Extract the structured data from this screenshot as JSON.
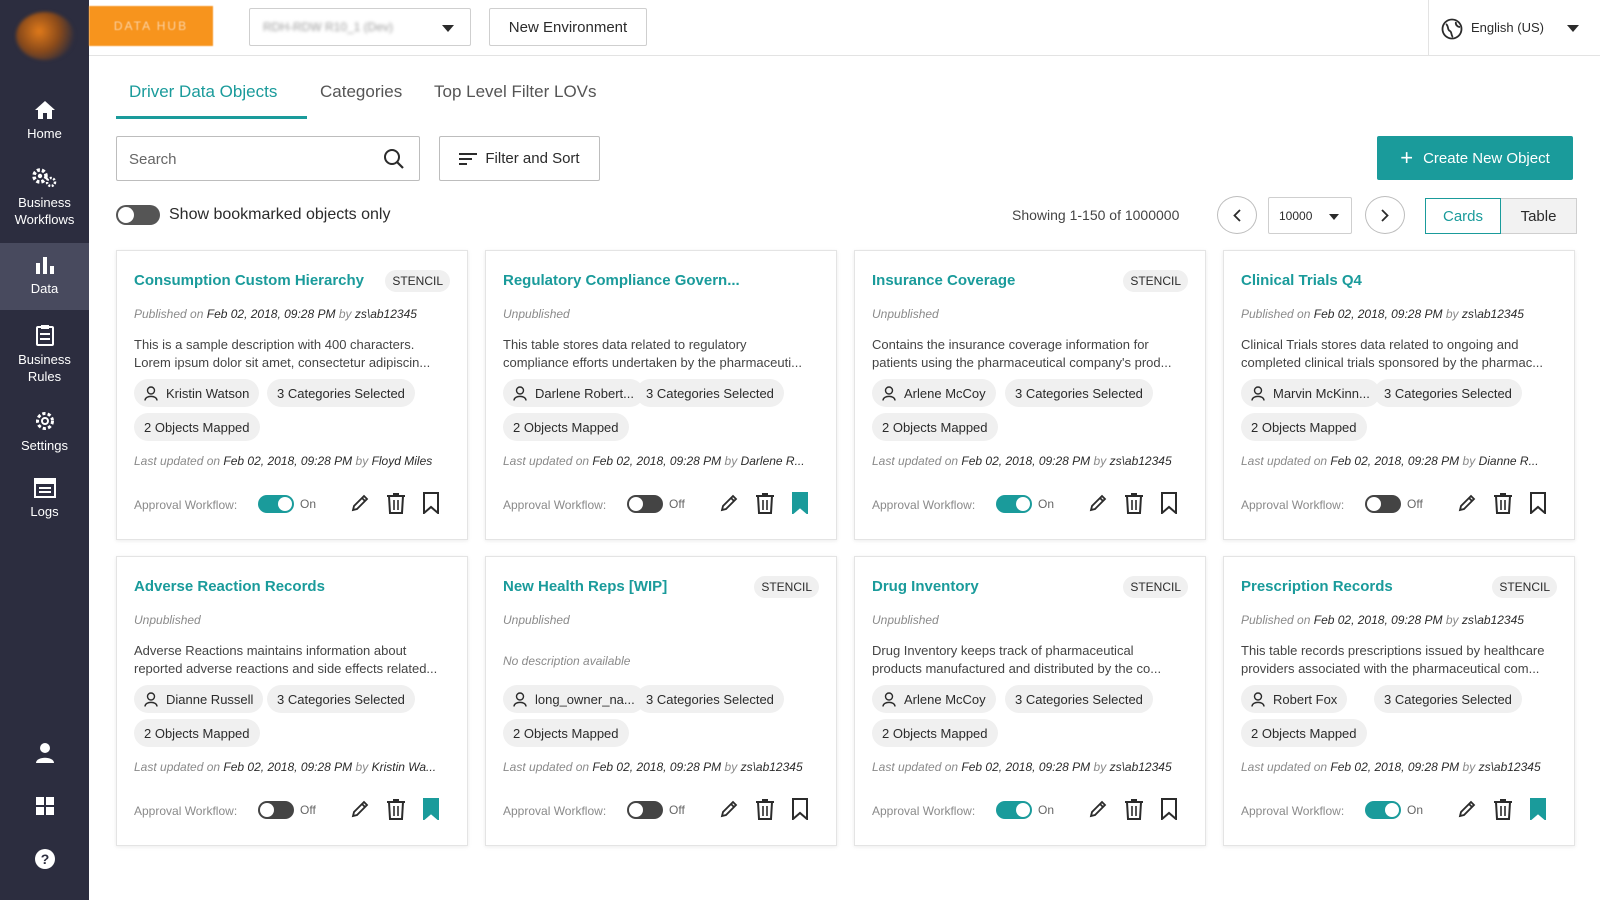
{
  "sidebar": {
    "items": [
      {
        "label": "Home",
        "icon": "home-icon"
      },
      {
        "label": "Business\nWorkflows",
        "icon": "cogs-icon"
      },
      {
        "label": "Data",
        "icon": "bar-chart-icon"
      },
      {
        "label": "Business\nRules",
        "icon": "clipboard-icon"
      },
      {
        "label": "Settings",
        "icon": "gear-icon"
      },
      {
        "label": "Logs",
        "icon": "logs-icon"
      }
    ],
    "bottom": [
      "user-icon",
      "grid-icon",
      "help-icon"
    ]
  },
  "topbar": {
    "brand": "DATA HUB",
    "env_value": "RDH-RDW R10_1 (Dev)",
    "new_env_label": "New Environment",
    "language": "English (US)"
  },
  "tabs": [
    "Driver Data Objects",
    "Categories",
    "Top Level Filter LOVs"
  ],
  "toolbar": {
    "search_placeholder": "Search",
    "filter_label": "Filter and Sort",
    "create_label": "Create New Object",
    "bookmark_label": "Show bookmarked objects only",
    "showing": "Showing 1-150 of 1000000",
    "per_page": "10000",
    "view_cards": "Cards",
    "view_table": "Table"
  },
  "labels": {
    "published_on": "Published on",
    "by": "by",
    "last_updated_on": "Last updated on",
    "approval_workflow": "Approval Workflow:"
  },
  "colors": {
    "accent": "#1a9b9b",
    "brand": "#f7941d",
    "sidebar": "#2c2d3f"
  },
  "cards": [
    {
      "title": "Consumption Custom Hierarchy",
      "stencil": "STENCIL",
      "status": "published",
      "unpublished": "",
      "published_date": "Feb 02, 2018, 09:28 PM",
      "published_by": "zs\\ab12345",
      "desc1": "This is a sample description with 400 characters.",
      "desc2": "Lorem ipsum dolor sit amet, consectetur adipiscin...",
      "owner": "Kristin Watson",
      "categories": "3 Categories Selected",
      "objects": "2 Objects Mapped",
      "updated_date": "Feb 02, 2018, 09:28 PM",
      "updated_by": "Floyd Miles",
      "workflow": "On",
      "bookmarked": false
    },
    {
      "title": "Regulatory Compliance Govern...",
      "stencil": "",
      "status": "unpublished",
      "unpublished": "Unpublished",
      "published_date": "",
      "published_by": "",
      "desc1": "This table stores data related to regulatory",
      "desc2": "compliance efforts undertaken by the pharmaceuti...",
      "owner": "Darlene Robert...",
      "categories": "3 Categories Selected",
      "objects": "2 Objects Mapped",
      "updated_date": "Feb 02, 2018, 09:28 PM",
      "updated_by": "Darlene R...",
      "workflow": "Off",
      "bookmarked": true
    },
    {
      "title": "Insurance Coverage",
      "stencil": "STENCIL",
      "status": "unpublished",
      "unpublished": "Unpublished",
      "published_date": "",
      "published_by": "",
      "desc1": "Contains the insurance coverage information for",
      "desc2": "patients using the pharmaceutical company's prod...",
      "owner": "Arlene McCoy",
      "categories": "3 Categories Selected",
      "objects": "2 Objects Mapped",
      "updated_date": "Feb 02, 2018, 09:28 PM",
      "updated_by": "zs\\ab12345",
      "workflow": "On",
      "bookmarked": false
    },
    {
      "title": "Clinical Trials Q4",
      "stencil": "",
      "status": "published",
      "unpublished": "",
      "published_date": "Feb 02, 2018, 09:28 PM",
      "published_by": "zs\\ab12345",
      "desc1": "Clinical Trials stores data related to ongoing and",
      "desc2": "completed clinical trials sponsored by the pharmac...",
      "owner": "Marvin McKinn...",
      "categories": "3 Categories Selected",
      "objects": "2 Objects Mapped",
      "updated_date": "Feb 02, 2018, 09:28 PM",
      "updated_by": "Dianne R...",
      "workflow": "Off",
      "bookmarked": false
    },
    {
      "title": "Adverse Reaction Records",
      "stencil": "",
      "status": "unpublished",
      "unpublished": "Unpublished",
      "published_date": "",
      "published_by": "",
      "desc1": "Adverse Reactions maintains information about",
      "desc2": "reported adverse reactions and side effects related...",
      "owner": "Dianne Russell",
      "categories": "3 Categories Selected",
      "objects": "2 Objects Mapped",
      "updated_date": "Feb 02, 2018, 09:28 PM",
      "updated_by": "Kristin Wa...",
      "workflow": "Off",
      "bookmarked": true
    },
    {
      "title": "New Health Reps [WIP]",
      "stencil": "STENCIL",
      "status": "unpublished",
      "unpublished": "Unpublished",
      "published_date": "",
      "published_by": "",
      "desc1": "No description available",
      "desc2": "",
      "owner": "long_owner_na...",
      "categories": "3 Categories Selected",
      "objects": "2 Objects Mapped",
      "updated_date": "Feb 02, 2018, 09:28 PM",
      "updated_by": "zs\\ab12345",
      "workflow": "Off",
      "bookmarked": false
    },
    {
      "title": "Drug Inventory",
      "stencil": "STENCIL",
      "status": "unpublished",
      "unpublished": "Unpublished",
      "published_date": "",
      "published_by": "",
      "desc1": "Drug Inventory keeps track of pharmaceutical",
      "desc2": "products manufactured and distributed by the co...",
      "owner": "Arlene McCoy",
      "categories": "3 Categories Selected",
      "objects": "2 Objects Mapped",
      "updated_date": "Feb 02, 2018, 09:28 PM",
      "updated_by": "zs\\ab12345",
      "workflow": "On",
      "bookmarked": false
    },
    {
      "title": "Prescription Records",
      "stencil": "STENCIL",
      "status": "published",
      "unpublished": "",
      "published_date": "Feb 02, 2018, 09:28 PM",
      "published_by": "zs\\ab12345",
      "desc1": "This table records prescriptions issued by healthcare",
      "desc2": "providers associated with the pharmaceutical com...",
      "owner": "Robert Fox",
      "categories": "3 Categories Selected",
      "objects": "2 Objects Mapped",
      "updated_date": "Feb 02, 2018, 09:28 PM",
      "updated_by": "zs\\ab12345",
      "workflow": "On",
      "bookmarked": true
    }
  ]
}
